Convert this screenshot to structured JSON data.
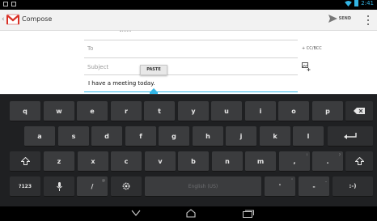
{
  "status_bar": {
    "time": "2:41"
  },
  "action_bar": {
    "title": "Compose",
    "send_label": "SEND"
  },
  "compose": {
    "to_placeholder": "To",
    "cc_bcc_label": "+ CC/BCC",
    "subject_placeholder": "Subject",
    "paste_label": "PASTE",
    "body_text": "I have a meeting today."
  },
  "keyboard": {
    "row1": [
      {
        "key": "q",
        "hint": ""
      },
      {
        "key": "w",
        "hint": ""
      },
      {
        "key": "e",
        "hint": ""
      },
      {
        "key": "r",
        "hint": ""
      },
      {
        "key": "t",
        "hint": ""
      },
      {
        "key": "y",
        "hint": ""
      },
      {
        "key": "u",
        "hint": ""
      },
      {
        "key": "i",
        "hint": ""
      },
      {
        "key": "o",
        "hint": ""
      },
      {
        "key": "p",
        "hint": ""
      }
    ],
    "row2": [
      {
        "key": "a",
        "hint": ""
      },
      {
        "key": "s",
        "hint": ""
      },
      {
        "key": "d",
        "hint": ""
      },
      {
        "key": "f",
        "hint": ""
      },
      {
        "key": "g",
        "hint": ""
      },
      {
        "key": "h",
        "hint": ""
      },
      {
        "key": "j",
        "hint": ""
      },
      {
        "key": "k",
        "hint": ""
      },
      {
        "key": "l",
        "hint": ""
      }
    ],
    "row3": [
      {
        "key": "z",
        "hint": ""
      },
      {
        "key": "x",
        "hint": ""
      },
      {
        "key": "c",
        "hint": ""
      },
      {
        "key": "v",
        "hint": ""
      },
      {
        "key": "b",
        "hint": ""
      },
      {
        "key": "n",
        "hint": ""
      },
      {
        "key": "m",
        "hint": ""
      },
      {
        "key": ",",
        "hint": "!"
      },
      {
        "key": ".",
        "hint": "?"
      }
    ],
    "symbols_label": "?123",
    "slash_label": "/",
    "slash_hint": "@",
    "space_label": "English (US)",
    "apostrophe_label": "'",
    "apostrophe_hint": "\"",
    "dash_label": "-",
    "dash_hint": "_",
    "smiley_label": ":-)"
  },
  "colors": {
    "accent": "#33b5e5",
    "keyboard_bg": "#1f2022",
    "key_bg": "#3b3c3e"
  }
}
